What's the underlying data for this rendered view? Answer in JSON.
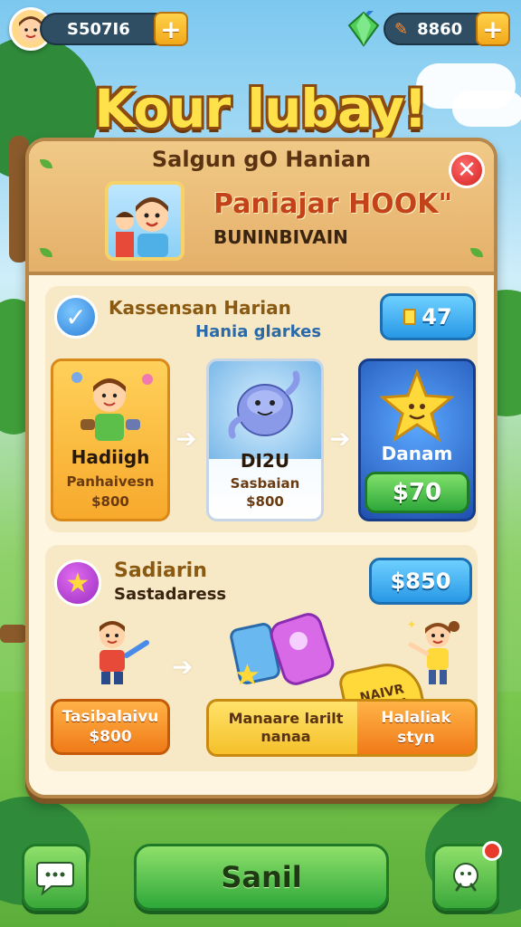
{
  "topbar": {
    "coins": "S507I6",
    "gems": "8860",
    "plus_label": "+"
  },
  "title": "Kour lubay!",
  "panel": {
    "subtitle": "Salgun gO Hanian",
    "close_label": "✕",
    "hero_title": "Paniajar HOOK\"",
    "hero_sub": "BUNINBIVAIN"
  },
  "section1": {
    "title": "Kassensan Harian",
    "subtitle": "Hania glarkes",
    "price": "47",
    "cards": [
      {
        "label": "Hadiigh",
        "sub1": "Panhaivesn",
        "sub2": "$800"
      },
      {
        "label": "DI2U",
        "sub1": "Sasbaian",
        "sub2": "$800"
      },
      {
        "label": "Danam",
        "button": "$70"
      }
    ]
  },
  "section2": {
    "title": "Sadiarin",
    "subtitle": "Sastadaress",
    "price": "$850",
    "left_btn": {
      "line1": "Tasibalaivu",
      "line2": "$800"
    },
    "middle_btn": {
      "line1": "Manaare larilt",
      "line2": "nanaa"
    },
    "right_btn": {
      "line1": "Halaliak",
      "line2": "styn"
    },
    "tag": "NAIVR CANNA"
  },
  "bottom": {
    "send_label": "Sanil"
  },
  "colors": {
    "accent_green": "#2ea83a",
    "accent_blue": "#2898e6",
    "title_yellow": "#ffe14a",
    "close_red": "#d42020"
  }
}
